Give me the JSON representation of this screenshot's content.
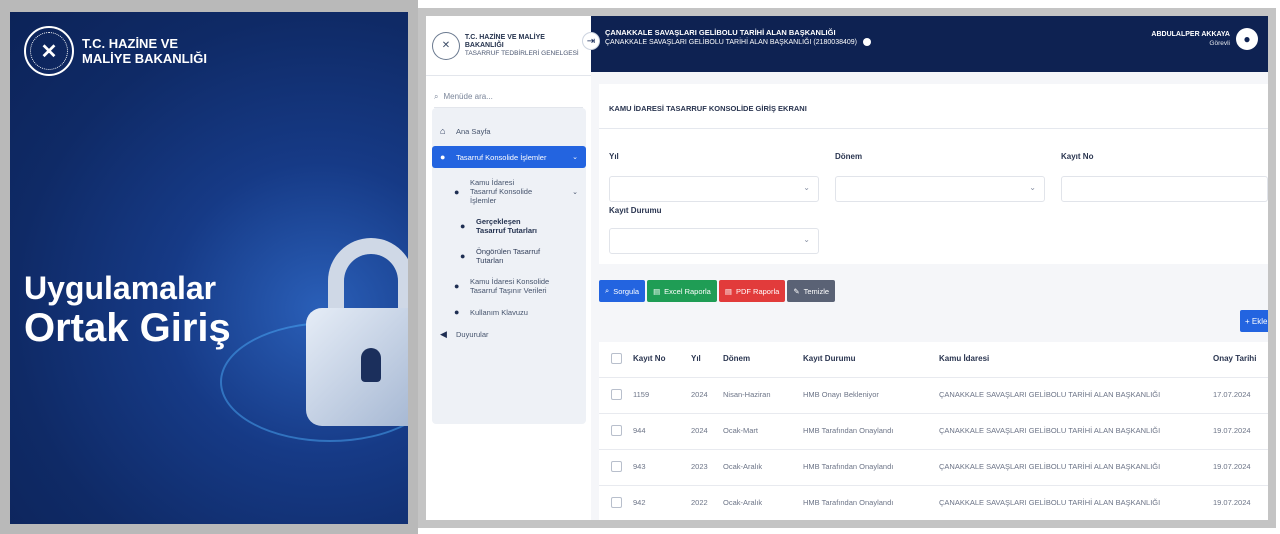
{
  "promo": {
    "ministry_line1": "T.C. HAZİNE VE",
    "ministry_line2": "MALİYE BAKANLIĞI",
    "title_line1": "Uygulamalar",
    "title_line2": "Ortak Giriş",
    "icons": [
      "emblem-icon",
      "lock-icon"
    ]
  },
  "sidebar": {
    "org_line1": "T.C. HAZİNE VE MALİYE BAKANLIĞI",
    "org_line2": "TASARRUF TEDBİRLERİ GENELGESİ",
    "search_placeholder": "Menüde ara...",
    "items": [
      {
        "label": "Ana Sayfa",
        "icon": "home-icon"
      },
      {
        "label": "Tasarruf Konsolide İşlemler",
        "icon": "lock-icon"
      },
      {
        "label": "Kamu İdaresi Tasarruf Konsolide İşlemler",
        "icon": "lock-icon"
      },
      {
        "label": "Gerçekleşen Tasarruf Tutarları",
        "icon": "lock-icon"
      },
      {
        "label": "Öngörülen Tasarruf Tutarları",
        "icon": "lock-icon"
      },
      {
        "label": "Kamu İdaresi Konsolide Tasarruf Taşınır Verileri",
        "icon": "lock-icon"
      },
      {
        "label": "Kullanım Klavuzu",
        "icon": "lock-icon"
      },
      {
        "label": "Duyurular",
        "icon": "megaphone-icon"
      }
    ]
  },
  "topbar": {
    "line1": "ÇANAKKALE SAVAŞLARI GELİBOLU TARİHİ ALAN BAŞKANLIĞI",
    "line2": "ÇANAKKALE SAVAŞLARI GELİBOLU TARİHİ ALAN BAŞKANLIĞI (2180038409)",
    "user_name": "ABDULALPER AKKAYA",
    "user_role": "Görevli"
  },
  "form": {
    "title": "KAMU İDARESİ TASARRUF KONSOLİDE GİRİŞ EKRANI",
    "labels": {
      "year": "Yıl",
      "period": "Dönem",
      "record_no": "Kayıt No",
      "record_status": "Kayıt Durumu"
    }
  },
  "buttons": {
    "search": "Sorgula",
    "excel": "Excel Raporla",
    "pdf": "PDF Raporla",
    "clear": "Temizle",
    "add": "+ Ekle"
  },
  "table": {
    "headers": [
      "Kayıt No",
      "Yıl",
      "Dönem",
      "Kayıt Durumu",
      "Kamu İdaresi",
      "Onay Tarihi"
    ],
    "rows": [
      [
        "1159",
        "2024",
        "Nisan-Haziran",
        "HMB Onayı Bekleniyor",
        "ÇANAKKALE SAVAŞLARI GELİBOLU TARİHİ ALAN BAŞKANLIĞI",
        "17.07.2024"
      ],
      [
        "944",
        "2024",
        "Ocak-Mart",
        "HMB Tarafından Onaylandı",
        "ÇANAKKALE SAVAŞLARI GELİBOLU TARİHİ ALAN BAŞKANLIĞI",
        "19.07.2024"
      ],
      [
        "943",
        "2023",
        "Ocak-Aralık",
        "HMB Tarafından Onaylandı",
        "ÇANAKKALE SAVAŞLARI GELİBOLU TARİHİ ALAN BAŞKANLIĞI",
        "19.07.2024"
      ],
      [
        "942",
        "2022",
        "Ocak-Aralık",
        "HMB Tarafından Onaylandı",
        "ÇANAKKALE SAVAŞLARI GELİBOLU TARİHİ ALAN BAŞKANLIĞI",
        "19.07.2024"
      ]
    ]
  },
  "colors": {
    "brand_navy": "#0e2252",
    "accent_blue": "#2364e0",
    "excel_green": "#1f9d55",
    "pdf_red": "#e23b3b"
  }
}
